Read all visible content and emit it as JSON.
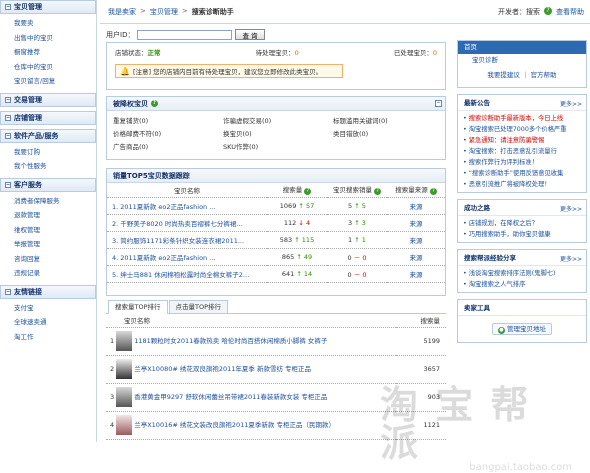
{
  "sidebar": [
    {
      "title": "宝贝管理",
      "items": [
        "我要卖",
        "出售中的宝贝",
        "橱窗推荐",
        "仓库中的宝贝",
        "宝贝留言/回复"
      ]
    },
    {
      "title": "交易管理",
      "items": []
    },
    {
      "title": "店铺管理",
      "items": []
    },
    {
      "title": "软件产品/服务",
      "items": [
        "我要订购",
        "我个性服务"
      ]
    },
    {
      "title": "客户服务",
      "items": [
        "消费者保障服务",
        "退款管理",
        "维权管理",
        "举报管理",
        "咨询回复",
        "违规记录"
      ]
    },
    {
      "title": "友情链接",
      "items": [
        "支付宝",
        "全球速卖通",
        "淘工作"
      ]
    }
  ],
  "header": {
    "breadcrumb": [
      "我是卖家",
      "宝贝管理",
      "搜索诊断助手"
    ],
    "seller_label": "开发者：搜索",
    "help": "查看帮助"
  },
  "search": {
    "label": "用户ID：",
    "value": "",
    "button": "查 询"
  },
  "status": {
    "store_label": "店铺状态：",
    "store_value": "正常",
    "pending_label": "待处理宝贝：",
    "pending_value": "0",
    "handled_label": "已处理宝贝：",
    "handled_value": "0",
    "notice": "[注意] 您的店铺内目前有待处理宝贝，建议您立即修改此类宝贝。"
  },
  "category": {
    "title": "被降权宝贝",
    "items": [
      "重复铺货(0)",
      "诈骗虚假交易(0)",
      "标题滥用关键词(0)",
      "价格邮费不符(0)",
      "换宝贝(0)",
      "类目错放(0)",
      "广告商品(0)",
      "SKU作弊(0)",
      ""
    ]
  },
  "top": {
    "title": "销量TOP5宝贝数据跟踪",
    "headers": [
      "宝贝名称",
      "搜索量",
      "宝贝搜索销量",
      "搜索量来源"
    ],
    "rows": [
      {
        "name": "1. 2011夏新款 eo2正品fashion ...",
        "search": "1069",
        "sd": "↑",
        "sdv": "57",
        "sales": "5",
        "sld": "↑",
        "slv": "5",
        "src": "来源",
        "sdc": "up",
        "slc": "up"
      },
      {
        "name": "2. 千野美子8020 时尚热卖百褶裤七分裤裙…",
        "search": "112",
        "sd": "↓",
        "sdv": "4",
        "sales": "3",
        "sld": "↑",
        "slv": "3",
        "src": "来源",
        "sdc": "dn",
        "slc": "up"
      },
      {
        "name": "3. 简约服饰1171彩条针织女装连衣裙2011...",
        "search": "583",
        "sd": "↑",
        "sdv": "115",
        "sales": "1",
        "sld": "↑",
        "slv": "1",
        "src": "来源",
        "sdc": "up",
        "slc": "up"
      },
      {
        "name": "4. 2011夏新款 eo2正品fashion ...",
        "search": "865",
        "sd": "↑",
        "sdv": "49",
        "sales": "0",
        "sld": "－",
        "slv": "0",
        "src": "来源",
        "sdc": "up",
        "slc": "dn"
      },
      {
        "name": "5. 绅士马881 休闲棉袍松露时尚全棉女裤子2…",
        "search": "641",
        "sd": "↑",
        "sdv": "14",
        "sales": "0",
        "sld": "－",
        "slv": "0",
        "src": "来源",
        "sdc": "up",
        "slc": "dn"
      }
    ]
  },
  "tabs": {
    "labels": [
      "搜索量TOP排行",
      "点击量TOP排行"
    ],
    "headers": [
      "宝贝名称",
      "搜索量"
    ],
    "rows": [
      {
        "idx": "1",
        "name": "1181颗粒时女2011春款热卖 哈伦时尚百搭休闲棉质小脚裤 女裤子",
        "value": "5199"
      },
      {
        "idx": "2",
        "name": "兰亭X10080# 绣花双良旗袍2011年夏季 新款雪纺 专柜正品",
        "value": "3657"
      },
      {
        "idx": "3",
        "name": "香港黄金甲9297 舒软休闲蕾丝吊带裙2011春装新款女装 专柜正品",
        "value": "903"
      },
      {
        "idx": "4",
        "name": "兰亭X10016# 绣花文装改良旗袍2011夏季新款 专柜正品（民期款）",
        "value": "1121"
      }
    ]
  },
  "right": {
    "nav": {
      "selected": "首页",
      "item": "宝贝诊断",
      "links": "我要提建议 ｜ 官方帮助"
    },
    "announce": {
      "title": "最新公告",
      "more": "更多>>",
      "items": [
        {
          "t": "搜索诊断助手最新版本，今日上线",
          "red": true
        },
        {
          "t": "淘宝搜索已处理7000多个价格严重",
          "red": false
        },
        {
          "t": "紧急通知：请注意防骗警惕",
          "red": true
        },
        {
          "t": "淘宝搜索：打击恶意乱引流量行",
          "red": false
        },
        {
          "t": "搜索作弊行为评判标准！",
          "red": false
        },
        {
          "t": "“搜索诊断助手”使用反馈意见收集",
          "red": false
        },
        {
          "t": "恶意引流推广将被降权处理！",
          "red": false
        }
      ]
    },
    "success": {
      "title": "成功之路",
      "more": "更多>>",
      "items": [
        "店铺规划，在降权之后？",
        "巧用搜索助手，助你宝贝健康"
      ]
    },
    "experience": {
      "title": "搜索帮派经验分享",
      "more": "更多>>",
      "items": [
        "浅谈淘宝搜索排序法则(鬼脚七)",
        "淘宝搜索之人气排序"
      ]
    },
    "tools": {
      "title": "卖家工具",
      "button": "管理宝贝地址"
    }
  },
  "watermark": {
    "line1": "淘 宝 帮 派",
    "line2": "bangpai.taobao.com"
  }
}
